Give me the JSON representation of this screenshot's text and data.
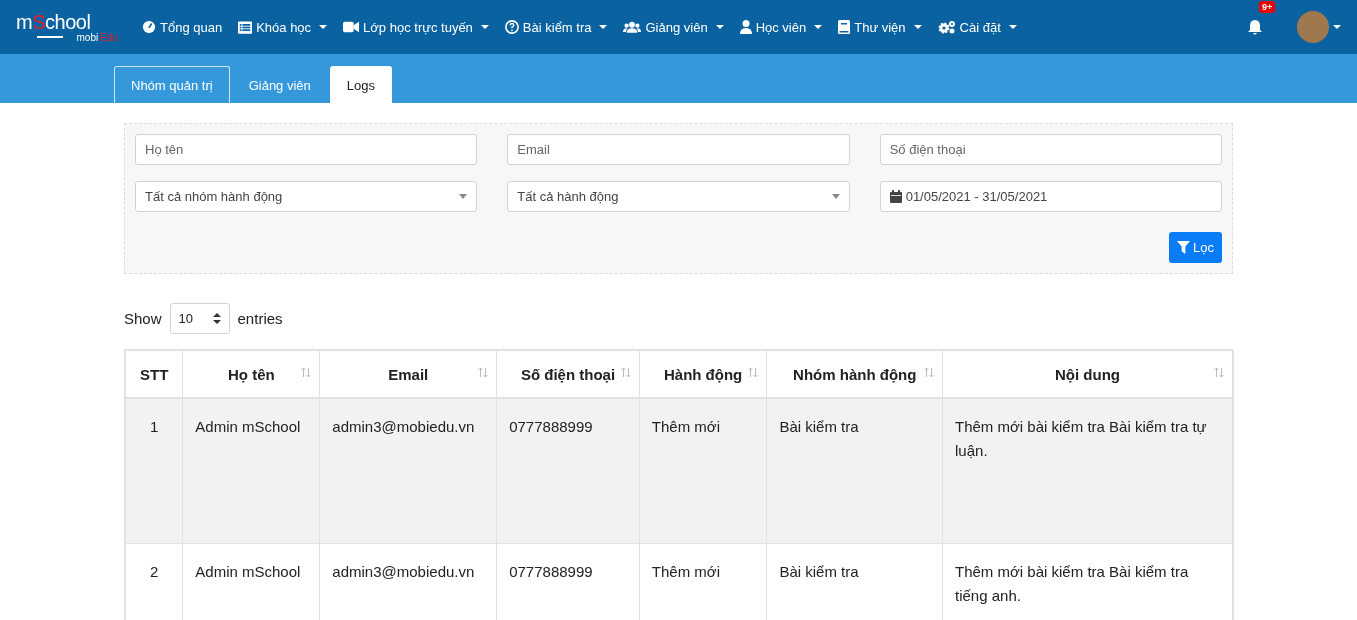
{
  "logo": {
    "parts": [
      {
        "text": "m",
        "accent": false
      },
      {
        "text": "S",
        "accent": true
      },
      {
        "text": "chool",
        "accent": false
      }
    ],
    "sub_parts": [
      {
        "text": "mobi",
        "accent": false
      },
      {
        "text": "Edu",
        "accent": true
      }
    ]
  },
  "nav": [
    {
      "label": "Tổng quan",
      "dropdown": false
    },
    {
      "label": "Khóa học",
      "dropdown": true
    },
    {
      "label": "Lớp học trực tuyến",
      "dropdown": true
    },
    {
      "label": "Bài kiểm tra",
      "dropdown": true
    },
    {
      "label": "Giảng viên",
      "dropdown": true
    },
    {
      "label": "Học viên",
      "dropdown": true
    },
    {
      "label": "Thư viện",
      "dropdown": true
    },
    {
      "label": "Cài đặt",
      "dropdown": true
    }
  ],
  "notifications": {
    "badge": "9+"
  },
  "tabs": [
    {
      "label": "Nhóm quản trị",
      "selected": false
    },
    {
      "label": "Giảng viên",
      "selected": false
    },
    {
      "label": "Logs",
      "selected": true
    }
  ],
  "filters": [
    {
      "kind": "text",
      "placeholder": "Họ tên"
    },
    {
      "kind": "text",
      "placeholder": "Email"
    },
    {
      "kind": "text",
      "placeholder": "Số điện thoại"
    },
    {
      "kind": "select",
      "value": "Tất cả nhóm hành động"
    },
    {
      "kind": "select",
      "value": "Tất cả hành động"
    },
    {
      "kind": "date",
      "value": "01/05/2021 - 31/05/2021"
    }
  ],
  "filter_button": "Lọc",
  "page_size": {
    "before": "Show",
    "value": "10",
    "after": "entries"
  },
  "table": {
    "columns": [
      {
        "label": "STT",
        "sortable": false
      },
      {
        "label": "Họ tên",
        "sortable": true
      },
      {
        "label": "Email",
        "sortable": true
      },
      {
        "label": "Số điện thoại",
        "sortable": true
      },
      {
        "label": "Hành động",
        "sortable": true
      },
      {
        "label": "Nhóm hành động",
        "sortable": true
      },
      {
        "label": "Nội dung",
        "sortable": true
      }
    ],
    "rows": [
      [
        "1",
        "Admin mSchool",
        "admin3@mobiedu.vn",
        "0777888999",
        "Thêm mới",
        "Bài kiểm tra",
        "Thêm mới bài kiểm tra Bài kiểm tra tự luận."
      ],
      [
        "2",
        "Admin mSchool",
        "admin3@mobiedu.vn",
        "0777888999",
        "Thêm mới",
        "Bài kiểm tra",
        "Thêm mới bài kiểm tra Bài kiểm tra tiếng anh."
      ]
    ]
  }
}
